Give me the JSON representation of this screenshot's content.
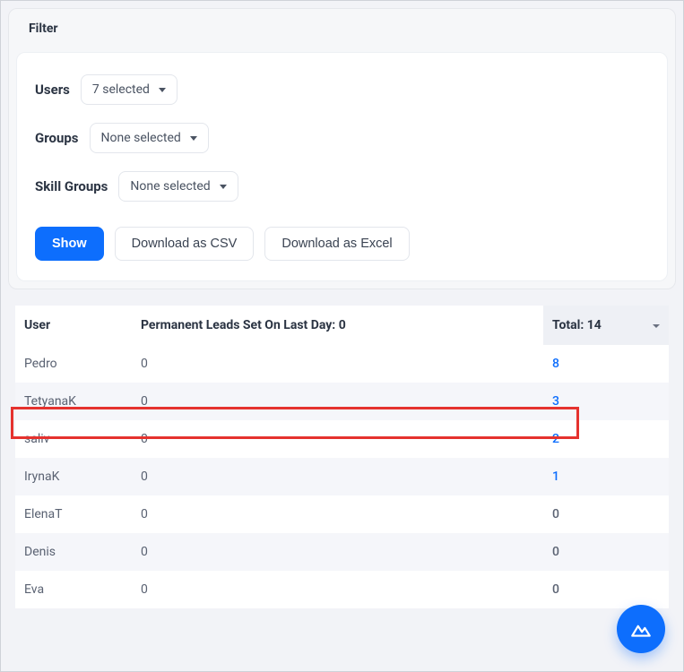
{
  "filter": {
    "title": "Filter",
    "users_label": "Users",
    "users_value": "7 selected",
    "groups_label": "Groups",
    "groups_value": "None selected",
    "skill_groups_label": "Skill Groups",
    "skill_groups_value": "None selected"
  },
  "actions": {
    "show": "Show",
    "csv": "Download as CSV",
    "excel": "Download as Excel"
  },
  "table": {
    "headers": {
      "user": "User",
      "leads": "Permanent Leads Set On Last Day: 0",
      "total": "Total: 14"
    },
    "rows": [
      {
        "user": "Pedro",
        "leads": "0",
        "total": "8",
        "link": true,
        "highlight": true
      },
      {
        "user": "TetyanaK",
        "leads": "0",
        "total": "3",
        "link": true,
        "highlight": false
      },
      {
        "user": "saliv",
        "leads": "0",
        "total": "2",
        "link": true,
        "highlight": false
      },
      {
        "user": "IrynaK",
        "leads": "0",
        "total": "1",
        "link": true,
        "highlight": false
      },
      {
        "user": "ElenaT",
        "leads": "0",
        "total": "0",
        "link": false,
        "highlight": false
      },
      {
        "user": "Denis",
        "leads": "0",
        "total": "0",
        "link": false,
        "highlight": false
      },
      {
        "user": "Eva",
        "leads": "0",
        "total": "0",
        "link": false,
        "highlight": false
      }
    ]
  }
}
